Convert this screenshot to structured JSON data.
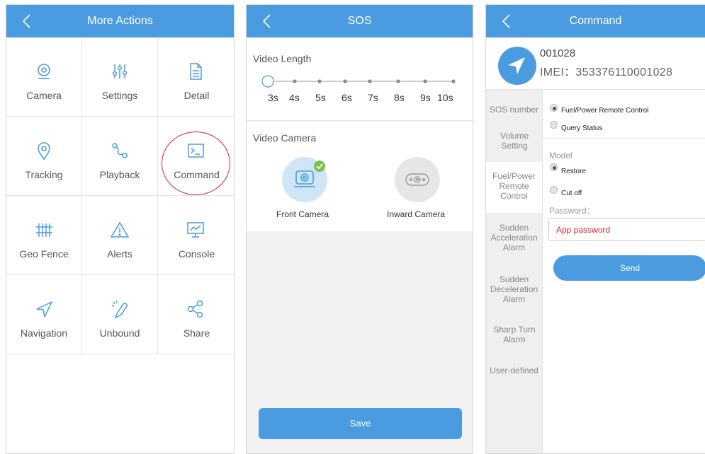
{
  "more_actions": {
    "title": "More Actions",
    "items": [
      {
        "label": "Camera",
        "icon": "camera-icon"
      },
      {
        "label": "Settings",
        "icon": "sliders-icon"
      },
      {
        "label": "Detail",
        "icon": "document-icon"
      },
      {
        "label": "Tracking",
        "icon": "location-pin-icon"
      },
      {
        "label": "Playback",
        "icon": "route-icon"
      },
      {
        "label": "Command",
        "icon": "terminal-icon"
      },
      {
        "label": "Geo Fence",
        "icon": "fence-icon"
      },
      {
        "label": "Alerts",
        "icon": "warning-icon"
      },
      {
        "label": "Console",
        "icon": "monitor-chart-icon"
      },
      {
        "label": "Navigation",
        "icon": "navigation-arrow-icon"
      },
      {
        "label": "Unbound",
        "icon": "unlink-icon"
      },
      {
        "label": "Share",
        "icon": "share-icon"
      }
    ],
    "highlighted_item": "Command"
  },
  "sos": {
    "title": "SOS",
    "video_length_label": "Video Length",
    "lengths": [
      "3s",
      "4s",
      "5s",
      "6s",
      "7s",
      "8s",
      "9s",
      "10s"
    ],
    "selected_length": "3s",
    "video_camera_label": "Video Camera",
    "cameras": [
      {
        "label": "Front Camera",
        "selected": true
      },
      {
        "label": "Inward Camera",
        "selected": false
      }
    ],
    "save_label": "Save"
  },
  "command": {
    "title": "Command",
    "device_id": "001028",
    "imei": "IMEI：353376110001028",
    "sidebar": [
      {
        "label": "SOS number"
      },
      {
        "label": "Volume Setting"
      },
      {
        "label": "Fuel/Power Remote Control",
        "active": true
      },
      {
        "label": "Sudden Acceleration Alarm"
      },
      {
        "label": "Sudden Deceleration Alarm"
      },
      {
        "label": "Sharp Turn Alarm"
      },
      {
        "label": "User-defined"
      }
    ],
    "options": [
      {
        "label": "Fuel/Power Remote Control",
        "selected": true
      },
      {
        "label": "Query Status",
        "selected": false
      }
    ],
    "model_label": "Model",
    "models": [
      {
        "label": "Restore",
        "selected": true
      },
      {
        "label": "Cut off",
        "selected": false
      }
    ],
    "password_label": "Password：",
    "password_placeholder": "App password",
    "send_label": "Send"
  },
  "colors": {
    "primary": "#4a9be0",
    "highlight_ring": "#d9232f",
    "check": "#7cc142"
  }
}
